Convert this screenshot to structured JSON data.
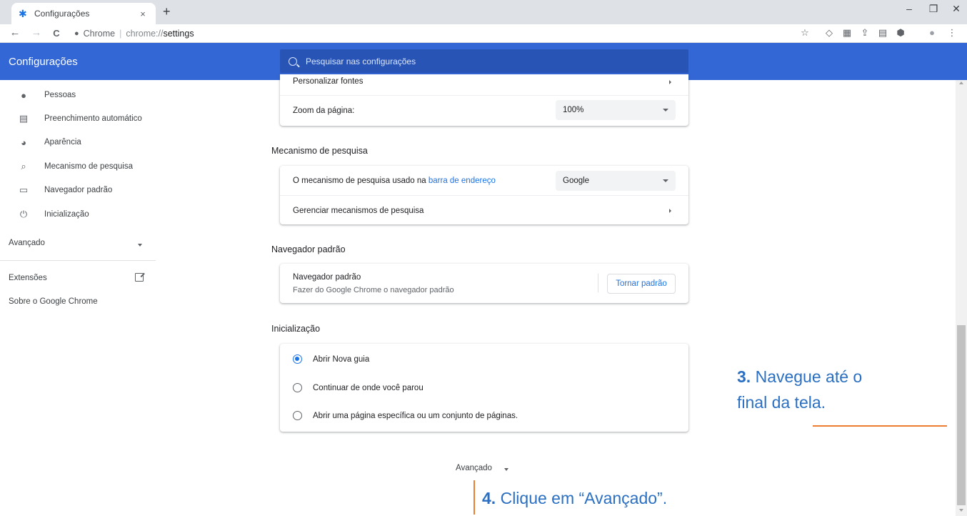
{
  "browser": {
    "tab_title": "Configurações",
    "tab_close": "×",
    "new_tab": "+",
    "window_controls": {
      "minimize": "–",
      "restore": "❐",
      "close": "✕"
    },
    "nav": {
      "back": "←",
      "forward": "→",
      "reload": "C"
    },
    "omnibox": {
      "site_label": "Chrome",
      "separator": "|",
      "scheme": "chrome://",
      "path": "settings"
    },
    "toolbar_icons": [
      "bookmark-star-icon",
      "pocket-icon",
      "extension-icon",
      "extension-icon",
      "extension-icon",
      "shield-icon",
      "profile-icon",
      "menu-icon"
    ],
    "toolbar_glyphs": {
      "star": "☆",
      "pocket": "◇",
      "ext1": "▦",
      "ext2": "⇪",
      "ext3": "▤",
      "shield": "⬢",
      "profile": "●",
      "menu": "⋮"
    }
  },
  "header": {
    "title": "Configurações",
    "search_placeholder": "Pesquisar nas configurações",
    "color": "#3367d6"
  },
  "sidebar": {
    "items": [
      {
        "label": "Pessoas",
        "icon": "person-icon",
        "glyph": "👤"
      },
      {
        "label": "Preenchimento automático",
        "icon": "clipboard-icon",
        "glyph": "▤"
      },
      {
        "label": "Aparência",
        "icon": "palette-icon",
        "glyph": "◕"
      },
      {
        "label": "Mecanismo de pesquisa",
        "icon": "search-icon",
        "glyph": "⌕"
      },
      {
        "label": "Navegador padrão",
        "icon": "browser-icon",
        "glyph": "▭"
      },
      {
        "label": "Inicialização",
        "icon": "power-icon",
        "glyph": "⏻"
      }
    ],
    "advanced": "Avançado",
    "extensions": "Extensões",
    "about": "Sobre o Google Chrome"
  },
  "main": {
    "appearance_card": {
      "fonts_label": "Personalizar fontes",
      "zoom_label": "Zoom da página:",
      "zoom_value": "100%"
    },
    "search_engine": {
      "section_title": "Mecanismo de pesquisa",
      "used_label_prefix": "O mecanismo de pesquisa usado na ",
      "used_label_link": "barra de endereço",
      "engine_value": "Google",
      "manage_label": "Gerenciar mecanismos de pesquisa"
    },
    "default_browser": {
      "section_title": "Navegador padrão",
      "label": "Navegador padrão",
      "sublabel": "Fazer do Google Chrome o navegador padrão",
      "button": "Tornar padrão"
    },
    "startup": {
      "section_title": "Inicialização",
      "options": [
        {
          "label": "Abrir Nova guia",
          "checked": true
        },
        {
          "label": "Continuar de onde você parou",
          "checked": false
        },
        {
          "label": "Abrir uma página específica ou um conjunto de páginas.",
          "checked": false
        }
      ]
    },
    "advanced_bottom": "Avançado"
  },
  "annotations": {
    "step3_number": "3.",
    "step3_line1": " Navegue até o",
    "step3_line2": "final da tela.",
    "step4_number": "4.",
    "step4_text": " Clique em “Avançado”.",
    "text_color": "#2a6fc2",
    "line_color": "#ed7d31"
  }
}
